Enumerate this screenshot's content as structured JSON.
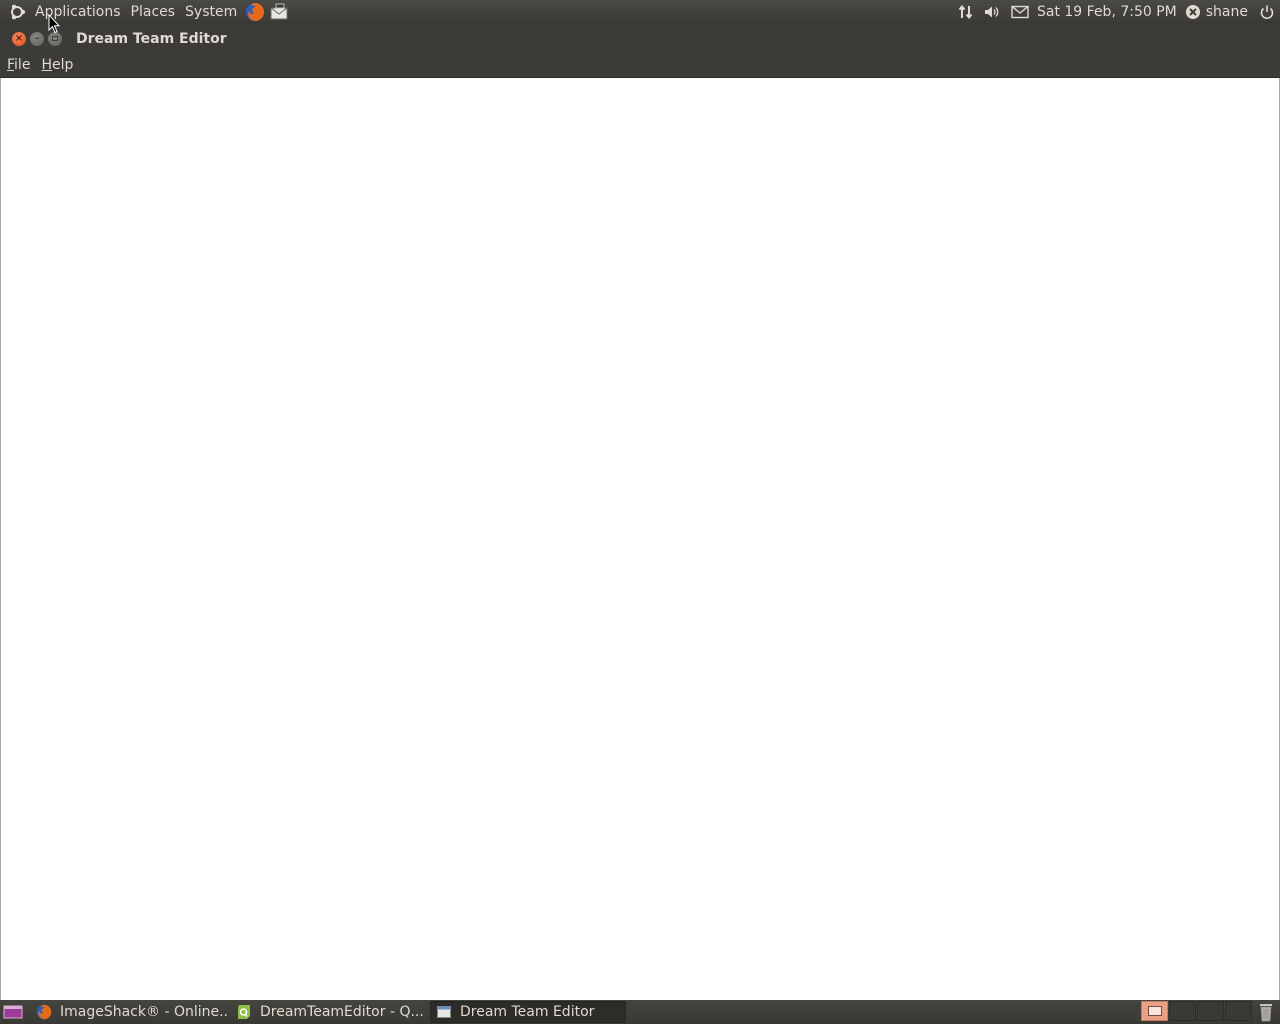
{
  "top_panel": {
    "menus": [
      "Applications",
      "Places",
      "System"
    ],
    "clock": "Sat 19 Feb,  7:50 PM",
    "user": "shane"
  },
  "window": {
    "title": "Dream Team Editor",
    "menubar": {
      "file": {
        "label_mnemonic": "F",
        "label_rest": "ile"
      },
      "help": {
        "label_mnemonic": "H",
        "label_rest": "elp"
      }
    }
  },
  "taskbar": {
    "tasks": [
      {
        "label": "ImageShack® - Online...",
        "icon": "firefox-icon"
      },
      {
        "label": "DreamTeamEditor - Q...",
        "icon": "qt-creator-icon"
      },
      {
        "label": "Dream Team Editor",
        "icon": "window-icon",
        "active": true
      }
    ]
  },
  "colors": {
    "panel_bg": "#3c3b37",
    "panel_text": "#dfdbd2",
    "close_button": "#df4a16",
    "active_workspace": "#e9a085"
  }
}
